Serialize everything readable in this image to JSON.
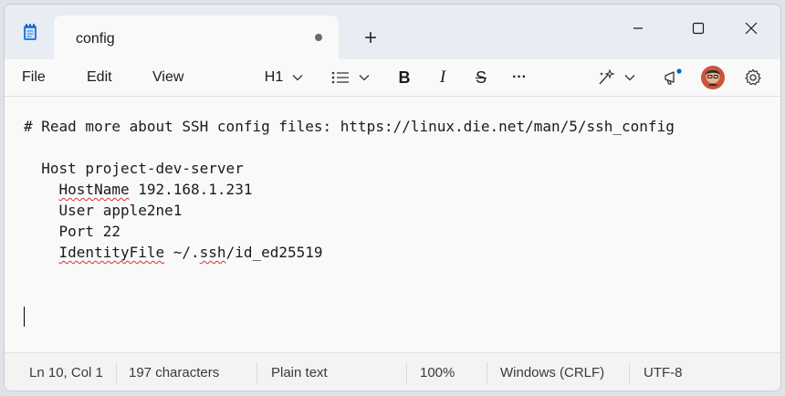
{
  "window": {
    "tab_title": "config",
    "new_tab_symbol": "+",
    "unsaved_indicator": "dot"
  },
  "menu": {
    "file": "File",
    "edit": "Edit",
    "view": "View"
  },
  "toolbar": {
    "heading_label": "H1",
    "tools": [
      "list-icon",
      "bold-icon",
      "italic-icon",
      "strikethrough-icon",
      "more-icon",
      "copilot-icon",
      "announcement-icon",
      "avatar",
      "gear-icon"
    ],
    "bold_label": "B",
    "italic_label": "I",
    "strike_label": "S",
    "more_label": "···"
  },
  "document": {
    "line1": "# Read more about SSH config files: https://linux.die.net/man/5/ssh_config",
    "line2": "",
    "line3": "  Host project-dev-server",
    "line4_pre": "    ",
    "line4_word": "HostName",
    "line4_post": " 192.168.1.231",
    "line5": "    User apple2ne1",
    "line6": "    Port 22",
    "line7_pre": "    ",
    "line7_word": "IdentityFile",
    "line7_mid": " ~/.",
    "line7_word2": "ssh",
    "line7_post": "/id_ed25519"
  },
  "status": {
    "position": "Ln 10, Col 1",
    "characters": "197 characters",
    "format": "Plain text",
    "zoom": "100%",
    "line_ending": "Windows (CRLF)",
    "encoding": "UTF-8"
  },
  "colors": {
    "accent": "#0067c0",
    "spellcheck": "#d13438"
  }
}
